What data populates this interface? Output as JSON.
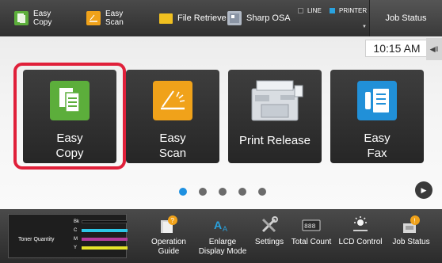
{
  "topbar": {
    "easy_copy": {
      "line1": "Easy",
      "line2": "Copy",
      "icon": "easy-copy-icon"
    },
    "easy_scan": {
      "line1": "Easy",
      "line2": "Scan",
      "icon": "easy-scan-icon"
    },
    "file_retrieve": {
      "label": "File Retrieve",
      "icon": "folder-icon"
    },
    "sharp_osa": {
      "label": "Sharp OSA",
      "icon": "osa-icon"
    },
    "line_status": {
      "label": "LINE",
      "color": "#3a3a3a"
    },
    "printer_status": {
      "label": "PRINTER",
      "color": "#29a3e0"
    },
    "job_status_label": "Job Status"
  },
  "clock": "10:15 AM",
  "tiles": [
    {
      "id": "easy-copy",
      "line1": "Easy",
      "line2": "Copy",
      "icon": "easy-copy-icon",
      "color": "#5cae3b",
      "selected": true
    },
    {
      "id": "easy-scan",
      "line1": "Easy",
      "line2": "Scan",
      "icon": "easy-scan-icon",
      "color": "#f0a21a",
      "selected": false
    },
    {
      "id": "print-release",
      "line1": "Print Release",
      "line2": "",
      "icon": "printer-icon",
      "selected": false
    },
    {
      "id": "easy-fax",
      "line1": "Easy",
      "line2": "Fax",
      "icon": "easy-fax-icon",
      "color": "#2190d8",
      "selected": false
    }
  ],
  "pagination": {
    "pages": 5,
    "current": 1,
    "active_color": "#1e90e0"
  },
  "toner": {
    "label": "Toner Quantity",
    "rows": [
      {
        "name": "Bk",
        "color": "#111111"
      },
      {
        "name": "C",
        "color": "#2cc6e6"
      },
      {
        "name": "M",
        "color": "#b43c9c"
      },
      {
        "name": "Y",
        "color": "#e6e22a"
      }
    ]
  },
  "bottom_items": [
    {
      "id": "operation-guide",
      "line1": "Operation",
      "line2": "Guide",
      "icon": "operation-guide-icon"
    },
    {
      "id": "enlarge-display",
      "line1": "Enlarge",
      "line2": "Display Mode",
      "icon": "enlarge-display-icon"
    },
    {
      "id": "settings",
      "line1": "Settings",
      "line2": "",
      "icon": "settings-icon"
    },
    {
      "id": "total-count",
      "line1": "Total Count",
      "line2": "",
      "icon": "total-count-icon"
    },
    {
      "id": "lcd-control",
      "line1": "LCD Control",
      "line2": "",
      "icon": "lcd-control-icon"
    },
    {
      "id": "job-status",
      "line1": "Job Status",
      "line2": "",
      "icon": "job-status-icon"
    }
  ],
  "highlight_color": "#e0203a"
}
